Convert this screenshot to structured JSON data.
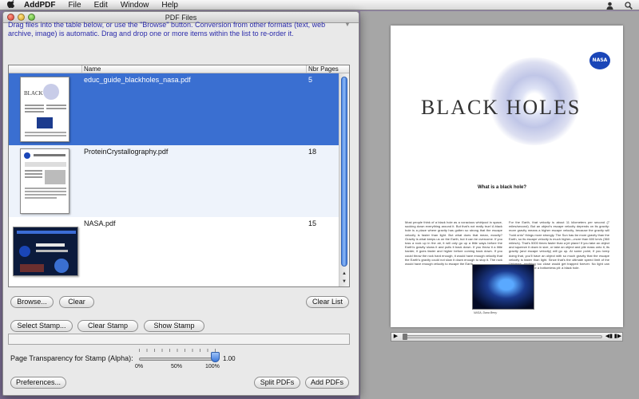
{
  "menubar": {
    "apple_icon": "apple-icon",
    "app_name": "AddPDF",
    "items": [
      {
        "label": "File"
      },
      {
        "label": "Edit"
      },
      {
        "label": "Window"
      },
      {
        "label": "Help"
      }
    ]
  },
  "window": {
    "title": "PDF Files",
    "instructions": "Drag files into the table below, or use the \"Browse\" button. Conversion from other formats (text, web archive, image) is automatic. Drag and drop one or more items within the list to re-order it."
  },
  "table": {
    "columns": [
      "Name",
      "Nbr Pages"
    ],
    "rows": [
      {
        "name": "educ_guide_blackholes_nasa.pdf",
        "pages": "5",
        "selected": true
      },
      {
        "name": "ProteinCrystallography.pdf",
        "pages": "18",
        "selected": false
      },
      {
        "name": "NASA.pdf",
        "pages": "15",
        "selected": false
      }
    ]
  },
  "buttons": {
    "browse": "Browse...",
    "clear": "Clear",
    "clear_list": "Clear List",
    "select_stamp": "Select Stamp...",
    "clear_stamp": "Clear Stamp",
    "show_stamp": "Show Stamp",
    "preferences": "Preferences...",
    "split_pdfs": "Split PDFs",
    "add_pdfs": "Add PDFs"
  },
  "alpha": {
    "label": "Page Transparency for Stamp (Alpha):",
    "value": "1.00",
    "tick_labels": [
      "0%",
      "50%",
      "100%"
    ]
  },
  "preview": {
    "logo_text": "NASA",
    "title": "BLACK HOLES",
    "heading": "What is a black hole?",
    "col1": "Most people think of a black hole as a voracious whirlpool in space, sucking down everything around it. But that's not really true! A black hole is a place where gravity has gotten so strong that the escape velocity is faster than light. But what does that mean, exactly? Gravity is what keeps us on the Earth, but it can be overcome. If you toss a rock up in the air, it will only go up a little ways before the Earth's gravity slows it and pulls it back down. If you throw it a little harder, it goes faster and higher before coming back down. If you could throw the rock hard enough, it would have enough velocity that the Earth's gravity could not slow it down enough to stop it. The rock would have enough velocity to escape the Earth.",
    "col2": "For the Earth, that velocity is about 11 kilometers per second (7 miles/second). But an object's escape velocity depends on its gravity: more gravity means a higher escape velocity, because the gravity will \"hold onto\" things more strongly. The Sun has far more gravity than the Earth, so its escape velocity is much higher—more than 600 km/s (360 miles/s). That's 5000 times faster than a jet plane! If you take an object and squeeze it down in size, or take an object and pile mass onto it, its gravity (and escape velocity) will go up. At some point, if you keep doing that, you'll have an object with so much gravity that the escape velocity is faster than light. Since that's the ultimate speed limit of the Universe, anything too close would get trapped forever. No light can escape, and it's like a bottomless pit: a black hole.",
    "caption": "NASA, Dana Berry"
  }
}
